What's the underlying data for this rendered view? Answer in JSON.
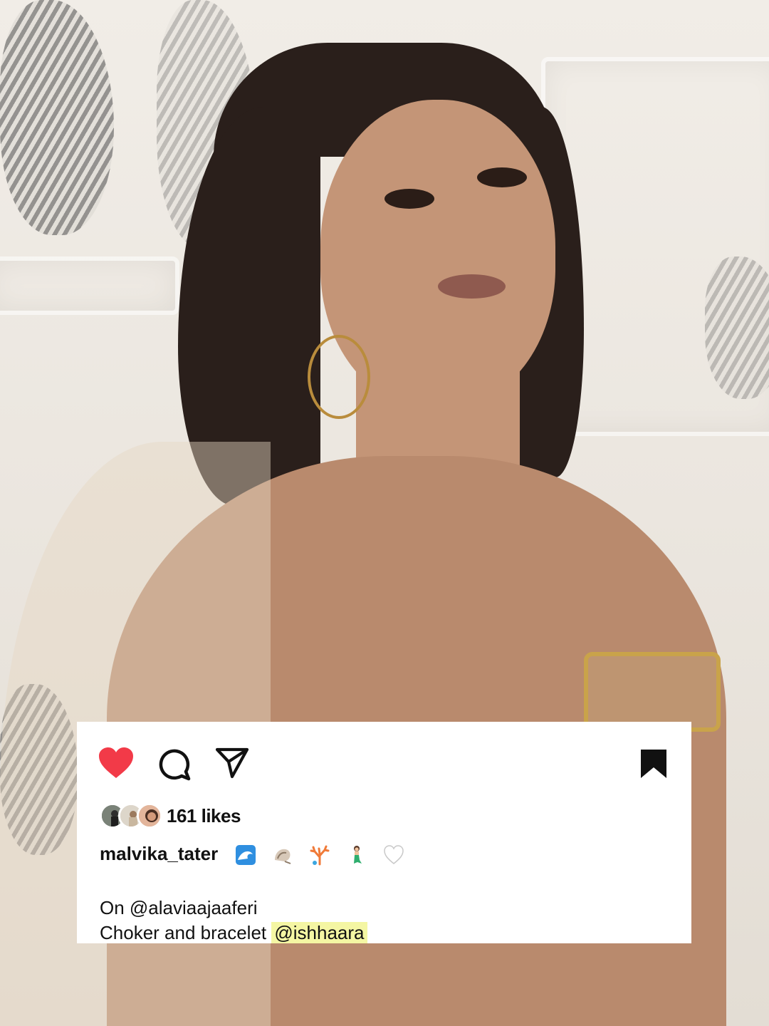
{
  "post": {
    "likes": "161 likes",
    "username": "malvika_tater",
    "caption_line1": "On @alaviaajaaferi",
    "caption_line2_prefix": "Choker and bracelet ",
    "caption_line2_mention": "@ishhaara",
    "liked": true,
    "saved": true
  },
  "icons": {
    "like": "heart-icon",
    "comment": "comment-icon",
    "share": "send-icon",
    "save": "bookmark-icon"
  },
  "colors": {
    "heart": "#f23a48",
    "text": "#111111",
    "mention_highlight": "#f4f6a3"
  }
}
